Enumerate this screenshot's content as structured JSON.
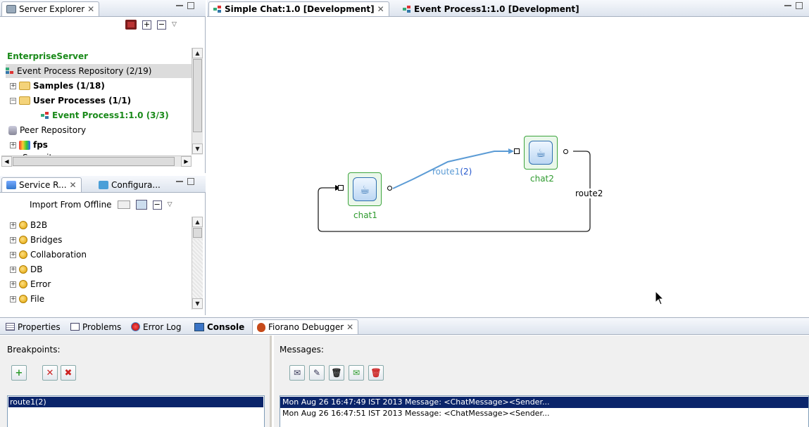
{
  "server_explorer": {
    "tab_label": "Server Explorer",
    "tree": {
      "server": "EnterpriseServer",
      "event_repo": "Event Process Repository (2/19)",
      "samples": "Samples (1/18)",
      "user_processes": "User Processes (1/1)",
      "event_process": "Event Process1:1.0 (3/3)",
      "peer_repo": "Peer Repository",
      "fps": "fps",
      "partial_item": "Security"
    }
  },
  "service_panel": {
    "tabs": [
      "Service R...",
      "Configura..."
    ],
    "import_label": "Import From Offline",
    "items": [
      "B2B",
      "Bridges",
      "Collaboration",
      "DB",
      "Error",
      "File"
    ]
  },
  "editor": {
    "tabs": [
      "Simple Chat:1.0 [Development]",
      "Event Process1:1.0 [Development]"
    ],
    "nodes": [
      {
        "label": "chat1"
      },
      {
        "label": "chat2"
      }
    ],
    "routes": [
      {
        "name": "route1",
        "count": "(2)"
      },
      {
        "name": "route2"
      }
    ],
    "colors": {
      "route_active": "#5b9bd5",
      "node_label": "#2e9a2e",
      "server_label": "#1a8a1a"
    }
  },
  "bottom": {
    "tabs": [
      "Properties",
      "Problems",
      "Error Log",
      "Console",
      "Fiorano Debugger"
    ],
    "breakpoints_label": "Breakpoints:",
    "breakpoints": [
      "route1(2)"
    ],
    "messages_label": "Messages:",
    "messages": [
      "Mon Aug 26 16:47:49 IST 2013 Message: <ChatMessage><Sender...",
      "Mon Aug 26 16:47:51 IST 2013 Message: <ChatMessage><Sender..."
    ],
    "selection_color": "#0a246a"
  }
}
